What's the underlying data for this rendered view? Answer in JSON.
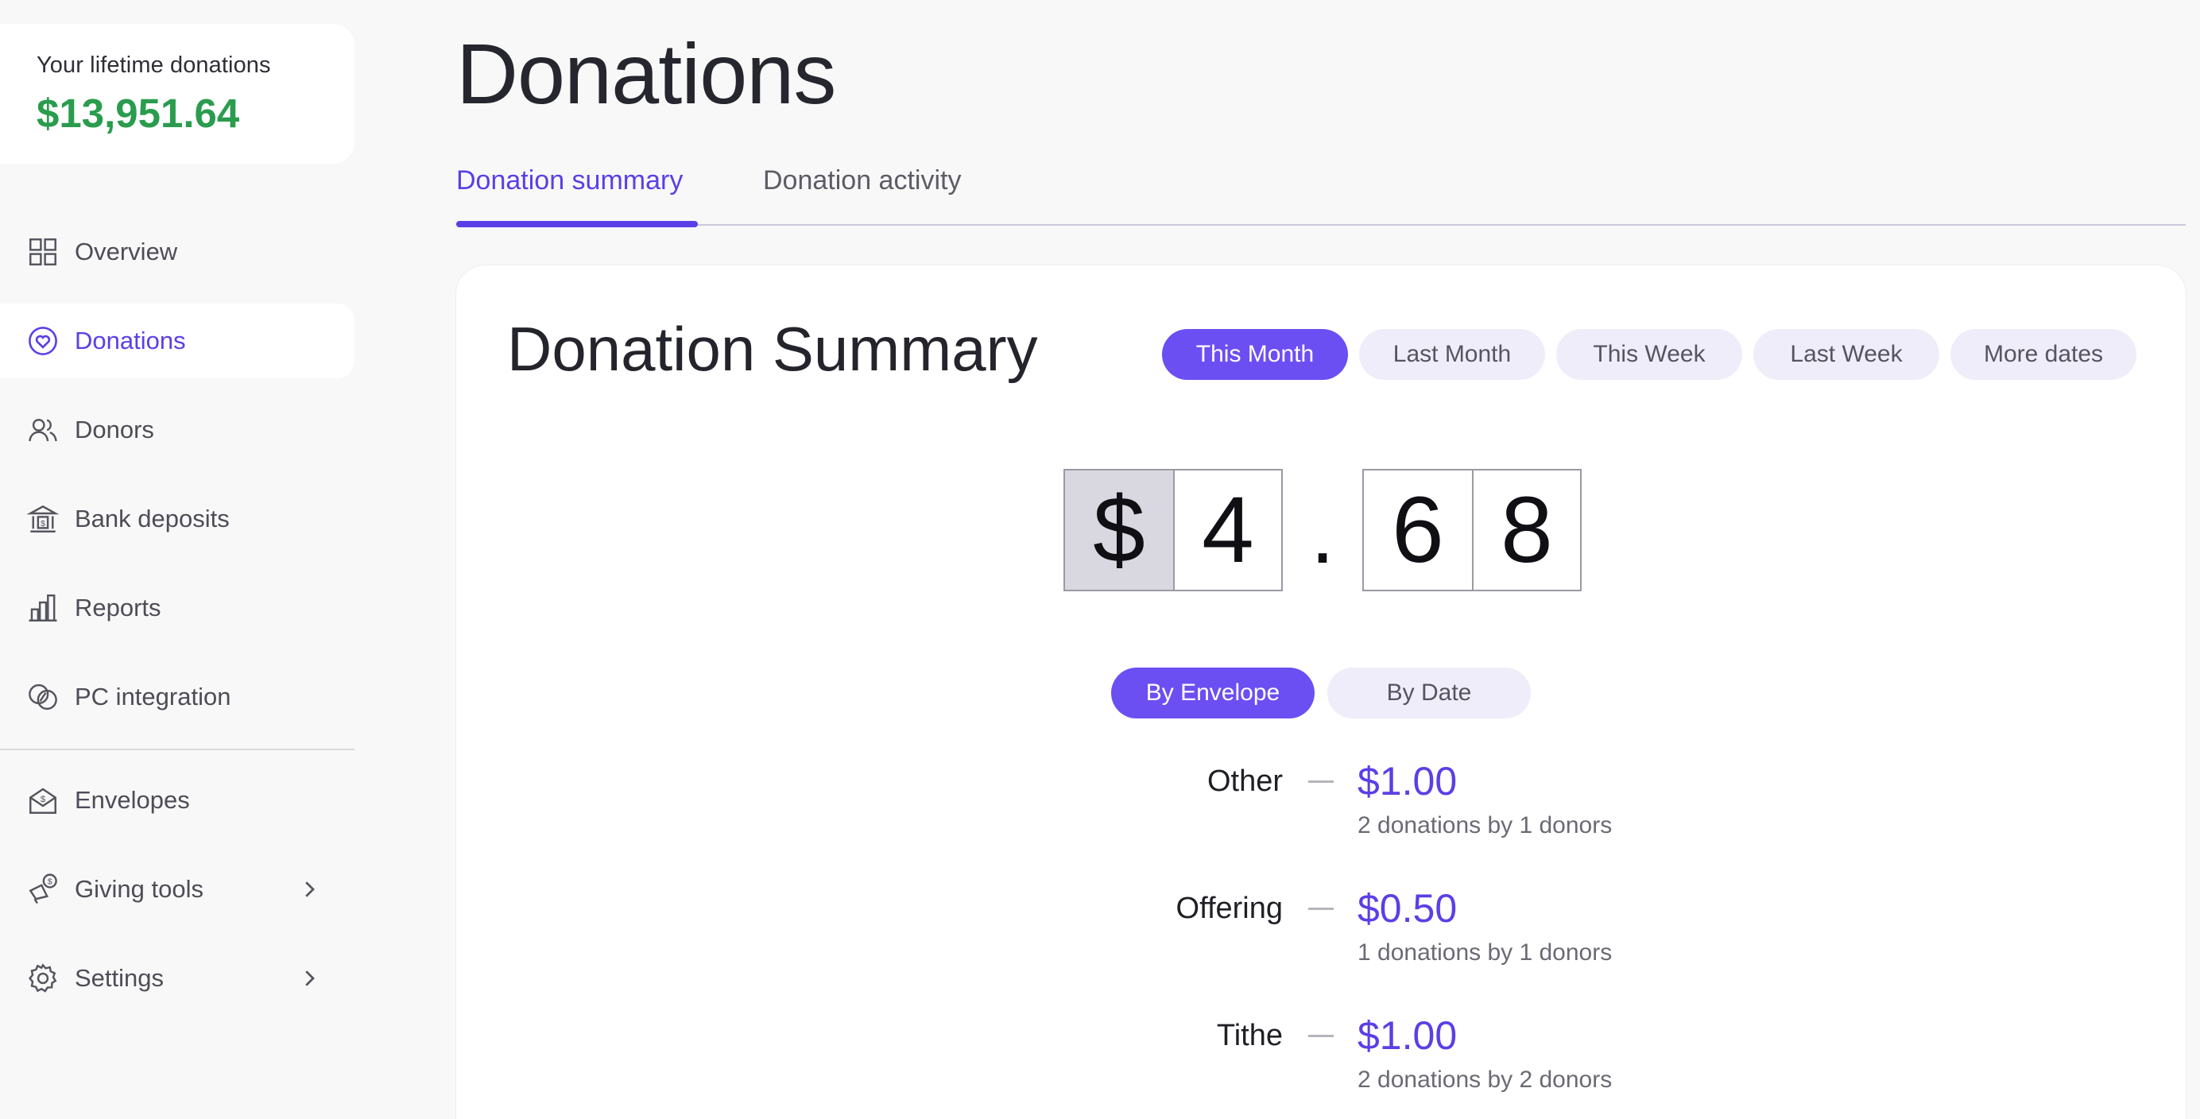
{
  "sidebar": {
    "lifetime_label": "Your lifetime donations",
    "lifetime_amount": "$13,951.64",
    "items": [
      {
        "label": "Overview",
        "icon": "grid-icon"
      },
      {
        "label": "Donations",
        "icon": "heart-circle-icon",
        "active": true
      },
      {
        "label": "Donors",
        "icon": "users-icon"
      },
      {
        "label": "Bank deposits",
        "icon": "bank-icon"
      },
      {
        "label": "Reports",
        "icon": "bar-chart-icon"
      },
      {
        "label": "PC integration",
        "icon": "link-circles-icon"
      },
      {
        "label": "Envelopes",
        "icon": "envelope-dollar-icon"
      },
      {
        "label": "Giving tools",
        "icon": "megaphone-dollar-icon",
        "has_submenu": true
      },
      {
        "label": "Settings",
        "icon": "gear-icon",
        "has_submenu": true
      }
    ]
  },
  "page": {
    "title": "Donations",
    "tabs": [
      {
        "label": "Donation summary",
        "active": true
      },
      {
        "label": "Donation activity",
        "active": false
      }
    ]
  },
  "summary": {
    "title": "Donation Summary",
    "date_filters": [
      {
        "label": "This Month",
        "active": true
      },
      {
        "label": "Last Month",
        "active": false
      },
      {
        "label": "This Week",
        "active": false
      },
      {
        "label": "Last Week",
        "active": false
      },
      {
        "label": "More dates",
        "active": false
      }
    ],
    "total": {
      "currency": "$",
      "whole": [
        "4"
      ],
      "separator": ".",
      "fraction": [
        "6",
        "8"
      ]
    },
    "view_toggle": [
      {
        "label": "By Envelope",
        "active": true
      },
      {
        "label": "By Date",
        "active": false
      }
    ],
    "envelopes": [
      {
        "name": "Other",
        "amount": "$1.00",
        "detail": "2 donations by 1 donors"
      },
      {
        "name": "Offering",
        "amount": "$0.50",
        "detail": "1 donations by 1 donors"
      },
      {
        "name": "Tithe",
        "amount": "$1.00",
        "detail": "2 donations by 2 donors"
      }
    ]
  },
  "colors": {
    "accent": "#5b3fe6",
    "accent_fill": "#6b4ff2",
    "lifetime_green": "#2a9c4e",
    "pill_bg": "#efedf9"
  }
}
